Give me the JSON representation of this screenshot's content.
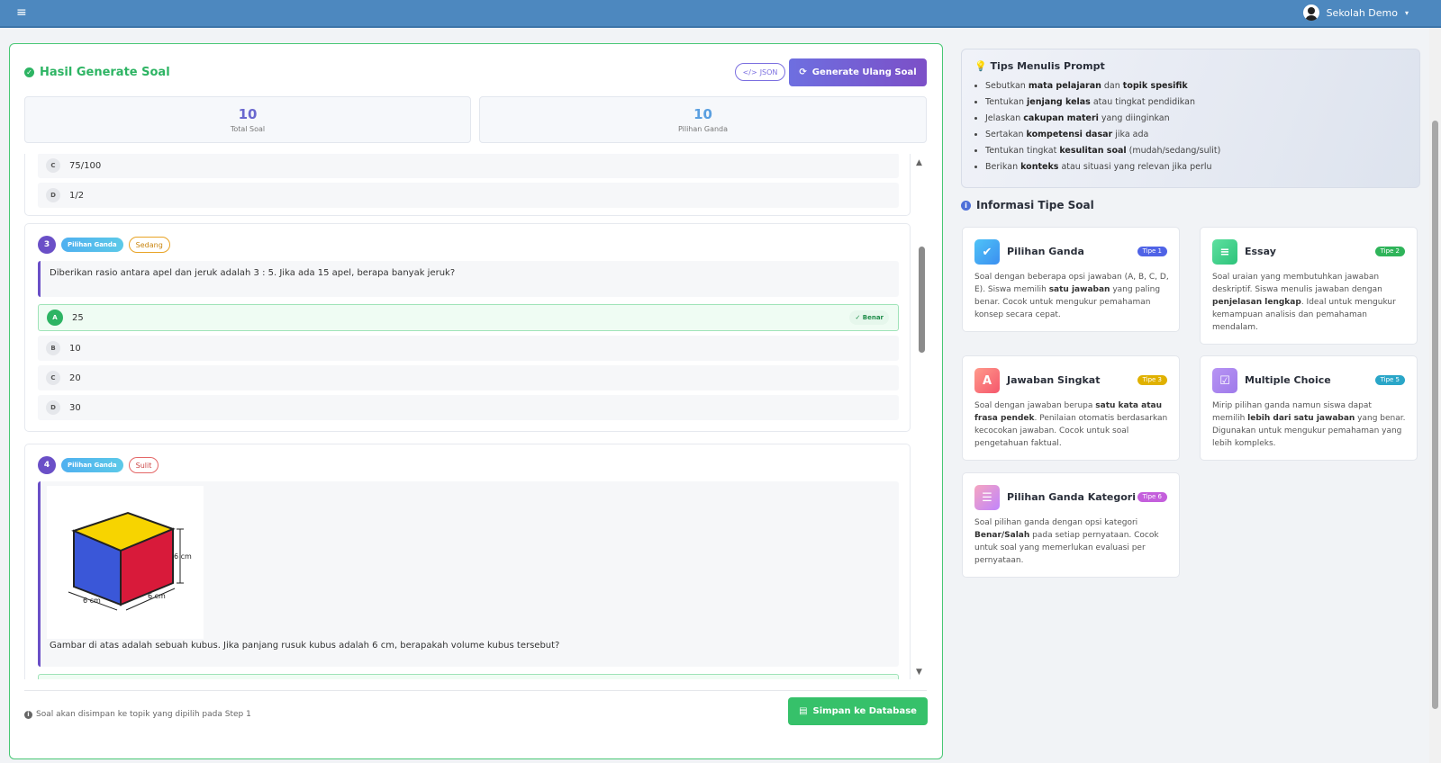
{
  "topbar": {
    "menu_icon": "hamburger-icon",
    "user_name": "Sekolah Demo",
    "user_caret": "▾"
  },
  "result": {
    "title": "Hasil Generate Soal",
    "json_label": "JSON",
    "regen_label": "Generate Ulang Soal",
    "stats": [
      {
        "value": "10",
        "label": "Total Soal"
      },
      {
        "value": "10",
        "label": "Pilihan Ganda"
      }
    ],
    "prev_options": [
      {
        "letter": "C",
        "text": "75/100"
      },
      {
        "letter": "D",
        "text": "1/2"
      }
    ],
    "q3": {
      "number": "3",
      "type": "Pilihan Ganda",
      "level": "Sedang",
      "text": "Diberikan rasio antara apel dan jeruk adalah 3 : 5. Jika ada 15 apel, berapa banyak jeruk?",
      "options": [
        {
          "letter": "A",
          "text": "25"
        },
        {
          "letter": "B",
          "text": "10"
        },
        {
          "letter": "C",
          "text": "20"
        },
        {
          "letter": "D",
          "text": "30"
        }
      ],
      "correct_label": "✓ Benar"
    },
    "q4": {
      "number": "4",
      "type": "Pilihan Ganda",
      "level": "Sulit",
      "image_labels": {
        "right": "6 cm",
        "front": "6 cm",
        "bottom": "6 cm"
      },
      "text": "Gambar di atas adalah sebuah kubus. Jika panjang rusuk kubus adalah 6 cm, berapakah volume kubus tersebut?"
    },
    "footer_note": "Soal akan disimpan ke topik yang dipilih pada Step 1",
    "save_label": "Simpan ke Database"
  },
  "tips": {
    "title": "Tips Menulis Prompt",
    "items": [
      {
        "pre": "Sebutkan ",
        "b1": "mata pelajaran",
        "mid": " dan ",
        "b2": "topik spesifik",
        "post": ""
      },
      {
        "pre": "Tentukan ",
        "b1": "jenjang kelas",
        "mid": " atau tingkat pendidikan",
        "b2": "",
        "post": ""
      },
      {
        "pre": "Jelaskan ",
        "b1": "cakupan materi",
        "mid": " yang diinginkan",
        "b2": "",
        "post": ""
      },
      {
        "pre": "Sertakan ",
        "b1": "kompetensi dasar",
        "mid": " jika ada",
        "b2": "",
        "post": ""
      },
      {
        "pre": "Tentukan tingkat ",
        "b1": "kesulitan soal",
        "mid": " (mudah/sedang/sulit)",
        "b2": "",
        "post": ""
      },
      {
        "pre": "Berikan ",
        "b1": "konteks",
        "mid": " atau situasi yang relevan jika perlu",
        "b2": "",
        "post": ""
      }
    ]
  },
  "info": {
    "title": "Informasi Tipe Soal",
    "types": [
      {
        "name": "Pilihan Ganda",
        "tag": "Tipe 1",
        "tag_color": "#4f63e6",
        "icon_bg": "linear-gradient(135deg,#4fc3f7,#3b8ff0)",
        "icon": "✔",
        "desc": [
          {
            "t": "Soal dengan beberapa opsi jawaban (A, B, C, D, E). Siswa memilih "
          },
          {
            "b": "satu jawaban"
          },
          {
            "t": " yang paling benar. Cocok untuk mengukur pemahaman konsep secara cepat."
          }
        ]
      },
      {
        "name": "Essay",
        "tag": "Tipe 2",
        "tag_color": "#2fb45a",
        "icon_bg": "linear-gradient(135deg,#5ee0a0,#2dc37a)",
        "icon": "≡",
        "desc": [
          {
            "t": "Soal uraian yang membutuhkan jawaban deskriptif. Siswa menulis jawaban dengan "
          },
          {
            "b": "penjelasan lengkap"
          },
          {
            "t": ". Ideal untuk mengukur kemampuan analisis dan pemahaman mendalam."
          }
        ]
      },
      {
        "name": "Jawaban Singkat",
        "tag": "Tipe 3",
        "tag_color": "#e0b100",
        "icon_bg": "linear-gradient(135deg,#ff9a8b,#f5576c)",
        "icon": "A",
        "desc": [
          {
            "t": "Soal dengan jawaban berupa "
          },
          {
            "b": "satu kata atau frasa pendek"
          },
          {
            "t": ". Penilaian otomatis berdasarkan kecocokan jawaban. Cocok untuk soal pengetahuan faktual."
          }
        ]
      },
      {
        "name": "Multiple Choice",
        "tag": "Tipe 5",
        "tag_color": "#2aa6c8",
        "icon_bg": "linear-gradient(135deg,#b794f4,#9f7aea)",
        "icon": "☑",
        "desc": [
          {
            "t": "Mirip pilihan ganda namun siswa dapat memilih "
          },
          {
            "b": "lebih dari satu jawaban"
          },
          {
            "t": " yang benar. Digunakan untuk mengukur pemahaman yang lebih kompleks."
          }
        ]
      },
      {
        "name": "Pilihan Ganda Kategori",
        "tag": "Tipe 6",
        "tag_color": "#c45fdc",
        "icon_bg": "linear-gradient(135deg,#f6a5c0,#c084fc)",
        "icon": "☰",
        "desc": [
          {
            "t": "Soal pilihan ganda dengan opsi kategori "
          },
          {
            "b": "Benar/Salah"
          },
          {
            "t": " pada setiap pernyataan. Cocok untuk soal yang memerlukan evaluasi per pernyataan."
          }
        ]
      }
    ]
  },
  "colors": {
    "topbar": "#4d88bf",
    "success": "#2db463",
    "accent": "#6a4fc7"
  }
}
